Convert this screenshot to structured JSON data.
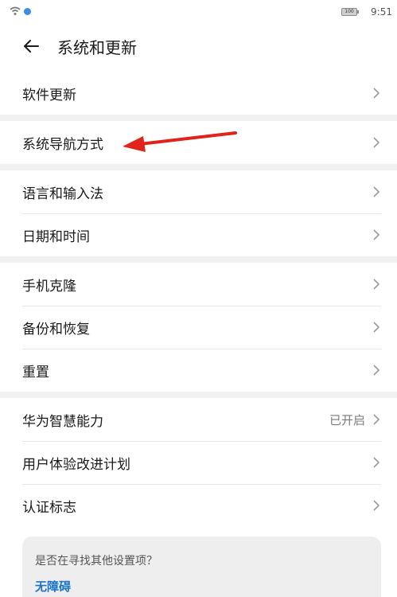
{
  "status_bar": {
    "time": "9:51",
    "battery_level": "100"
  },
  "header": {
    "title": "系统和更新",
    "back_icon": "back-arrow-icon"
  },
  "groups": [
    {
      "items": [
        {
          "label": "软件更新"
        }
      ]
    },
    {
      "items": [
        {
          "label": "系统导航方式"
        }
      ]
    },
    {
      "items": [
        {
          "label": "语言和输入法"
        },
        {
          "label": "日期和时间"
        }
      ]
    },
    {
      "items": [
        {
          "label": "手机克隆"
        },
        {
          "label": "备份和恢复"
        },
        {
          "label": "重置"
        }
      ]
    },
    {
      "items": [
        {
          "label": "华为智慧能力",
          "value": "已开启"
        },
        {
          "label": "用户体验改进计划"
        },
        {
          "label": "认证标志"
        }
      ]
    }
  ],
  "suggest": {
    "question": "是否在寻找其他设置项？",
    "link": "无障碍"
  },
  "colors": {
    "accent": "#1a73c9",
    "annotation_arrow": "#e0241b",
    "divider": "#e6e6e6",
    "gap": "#f1f1f1"
  }
}
